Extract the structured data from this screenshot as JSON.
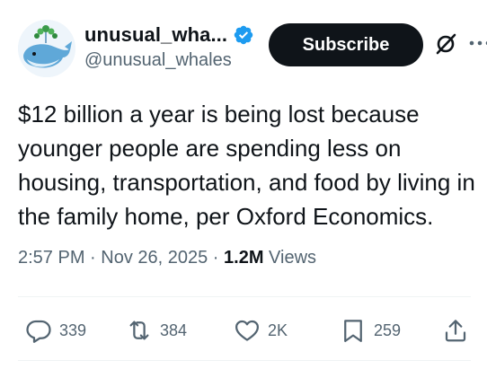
{
  "author": {
    "display_name": "unusual_wha...",
    "handle": "@unusual_whales",
    "verified": true
  },
  "buttons": {
    "subscribe": "Subscribe"
  },
  "icons": {
    "grok": "grok-icon",
    "more": "more-icon"
  },
  "tweet": {
    "text": "$12 billion a year is being lost because younger people are spending less on housing, transportation, and food by living in the family home, per Oxford Economics."
  },
  "meta": {
    "time": "2:57 PM",
    "separator1": " · ",
    "date": "Nov 26, 2025",
    "separator2": " · ",
    "views_count": "1.2M",
    "views_label": " Views"
  },
  "actions": {
    "replies": "339",
    "reposts": "384",
    "likes": "2K",
    "bookmarks": "259"
  },
  "colors": {
    "text": "#0f1419",
    "secondary": "#536471",
    "verified_blue": "#1d9bf0",
    "button_bg": "#0f1419"
  }
}
